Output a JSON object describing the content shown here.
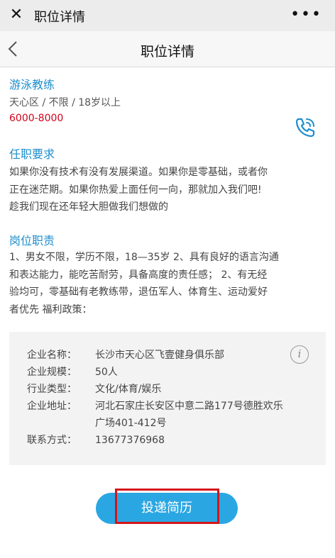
{
  "window": {
    "title": "职位详情",
    "close_icon": "close-icon",
    "more_icon": "more-icon",
    "more_label": "•••"
  },
  "nav": {
    "title": "职位详情",
    "back_icon": "chevron-left-icon"
  },
  "job": {
    "title": "游泳教练",
    "meta": "天心区 / 不限 / 18岁以上",
    "salary": "6000-8000",
    "salary_color": "#d0021b",
    "accent_color": "#1c8dcc"
  },
  "requirements": {
    "title": "任职要求",
    "text": "如果你没有技术有没有发展渠道。如果你是零基础，或者你\n正在迷茫期。如果你热爱上面任何一向，那就加入我们吧!\n趁我们现在还年轻大胆做我们想做的"
  },
  "duties": {
    "title": "岗位职责",
    "text": "1、男女不限，学历不限，18—35岁 2、具有良好的语言沟通\n和表达能力，能吃苦耐劳，具备高度的责任感； 2、有无经\n验均可，零基础有老教练带，退伍军人、体育生、运动爱好\n者优先 福利政策："
  },
  "company": {
    "rows": [
      {
        "label": "企业名称：",
        "value": "长沙市天心区飞壹健身俱乐部"
      },
      {
        "label": "企业规模：",
        "value": "50人"
      },
      {
        "label": "行业类型：",
        "value": "文化/体育/娱乐"
      },
      {
        "label": "企业地址：",
        "value": "河北石家庄长安区中意二路177号德胜欢乐广场401-412号"
      },
      {
        "label": "联系方式：",
        "value": "13677376968"
      }
    ]
  },
  "submit": {
    "label": "投递简历",
    "color": "#2aa7e3",
    "highlight_color": "#d4151b"
  }
}
